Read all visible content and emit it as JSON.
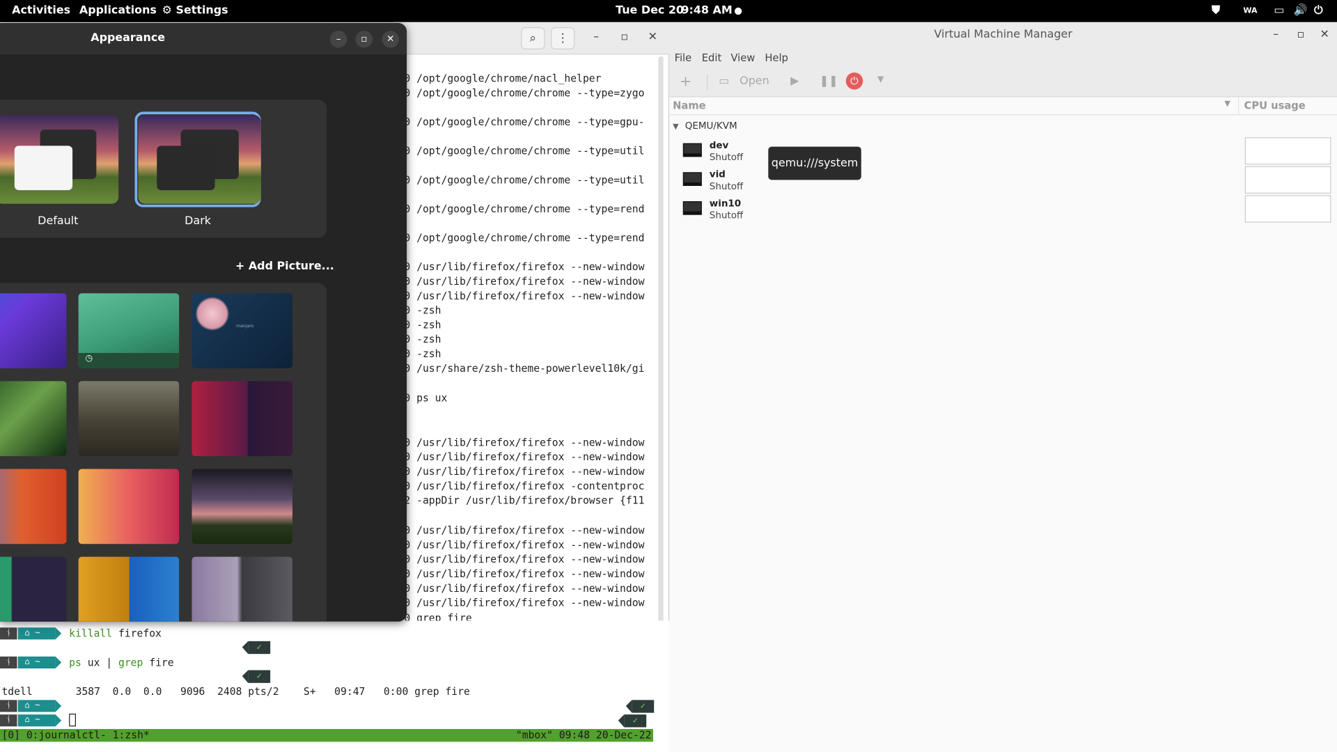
{
  "topbar": {
    "activities": "Activities",
    "applications": "Applications",
    "settings": "Settings",
    "date": "Tue Dec 20",
    "time": "9:48 AM",
    "tray_vpn": "WA"
  },
  "terminal": {
    "lines": [
      "0 /opt/google/chrome/nacl_helper",
      "0 /opt/google/chrome/chrome --type=zygo",
      "0 /opt/google/chrome/chrome --type=gpu-",
      "0 /opt/google/chrome/chrome --type=util",
      "0 /opt/google/chrome/chrome --type=util",
      "0 /opt/google/chrome/chrome --type=rend",
      "0 /opt/google/chrome/chrome --type=rend",
      "0 /usr/lib/firefox/firefox --new-window",
      "0 /usr/lib/firefox/firefox --new-window",
      "0 /usr/lib/firefox/firefox --new-window",
      "0 -zsh",
      "0 -zsh",
      "0 -zsh",
      "0 -zsh",
      "0 /usr/share/zsh-theme-powerlevel10k/gi",
      "0 ps ux",
      "0 /usr/lib/firefox/firefox --new-window",
      "0 /usr/lib/firefox/firefox --new-window",
      "0 /usr/lib/firefox/firefox --new-window",
      "0 /usr/lib/firefox/firefox -contentproc",
      "2 -appDir /usr/lib/firefox/browser {f11",
      "0 /usr/lib/firefox/firefox --new-window",
      "0 /usr/lib/firefox/firefox --new-window",
      "0 /usr/lib/firefox/firefox --new-window",
      "0 /usr/lib/firefox/firefox --new-window",
      "0 /usr/lib/firefox/firefox --new-window",
      "0 /usr/lib/firefox/firefox --new-window",
      "0 grep fire"
    ],
    "prompt_home": "~",
    "cmd1_a": "killall",
    "cmd1_b": " firefox",
    "cmd2_a": "ps",
    "cmd2_b": " ux | ",
    "cmd2_c": "grep",
    "cmd2_d": " fire",
    "ps_output": "tdell       3587  0.0  0.0   9096  2408 pts/2    S+   09:47   0:00 grep fire",
    "status_left": "[0] 0:journalctl- 1:zsh*",
    "status_right": "\"mbox\" 09:48 20-Dec-22"
  },
  "appearance": {
    "title": "Appearance",
    "style_default": "Default",
    "style_dark": "Dark",
    "add_picture": "Add Picture...",
    "wallpaper_brand_text": "manjaro"
  },
  "vmm": {
    "title": "Virtual Machine Manager",
    "menu": [
      "File",
      "Edit",
      "View",
      "Help"
    ],
    "open_label": "Open",
    "col_name": "Name",
    "col_cpu": "CPU usage",
    "group": "QEMU/KVM",
    "vms": [
      {
        "name": "dev",
        "state": "Shutoff"
      },
      {
        "name": "vid",
        "state": "Shutoff"
      },
      {
        "name": "win10",
        "state": "Shutoff"
      }
    ],
    "tooltip": "qemu:///system"
  }
}
